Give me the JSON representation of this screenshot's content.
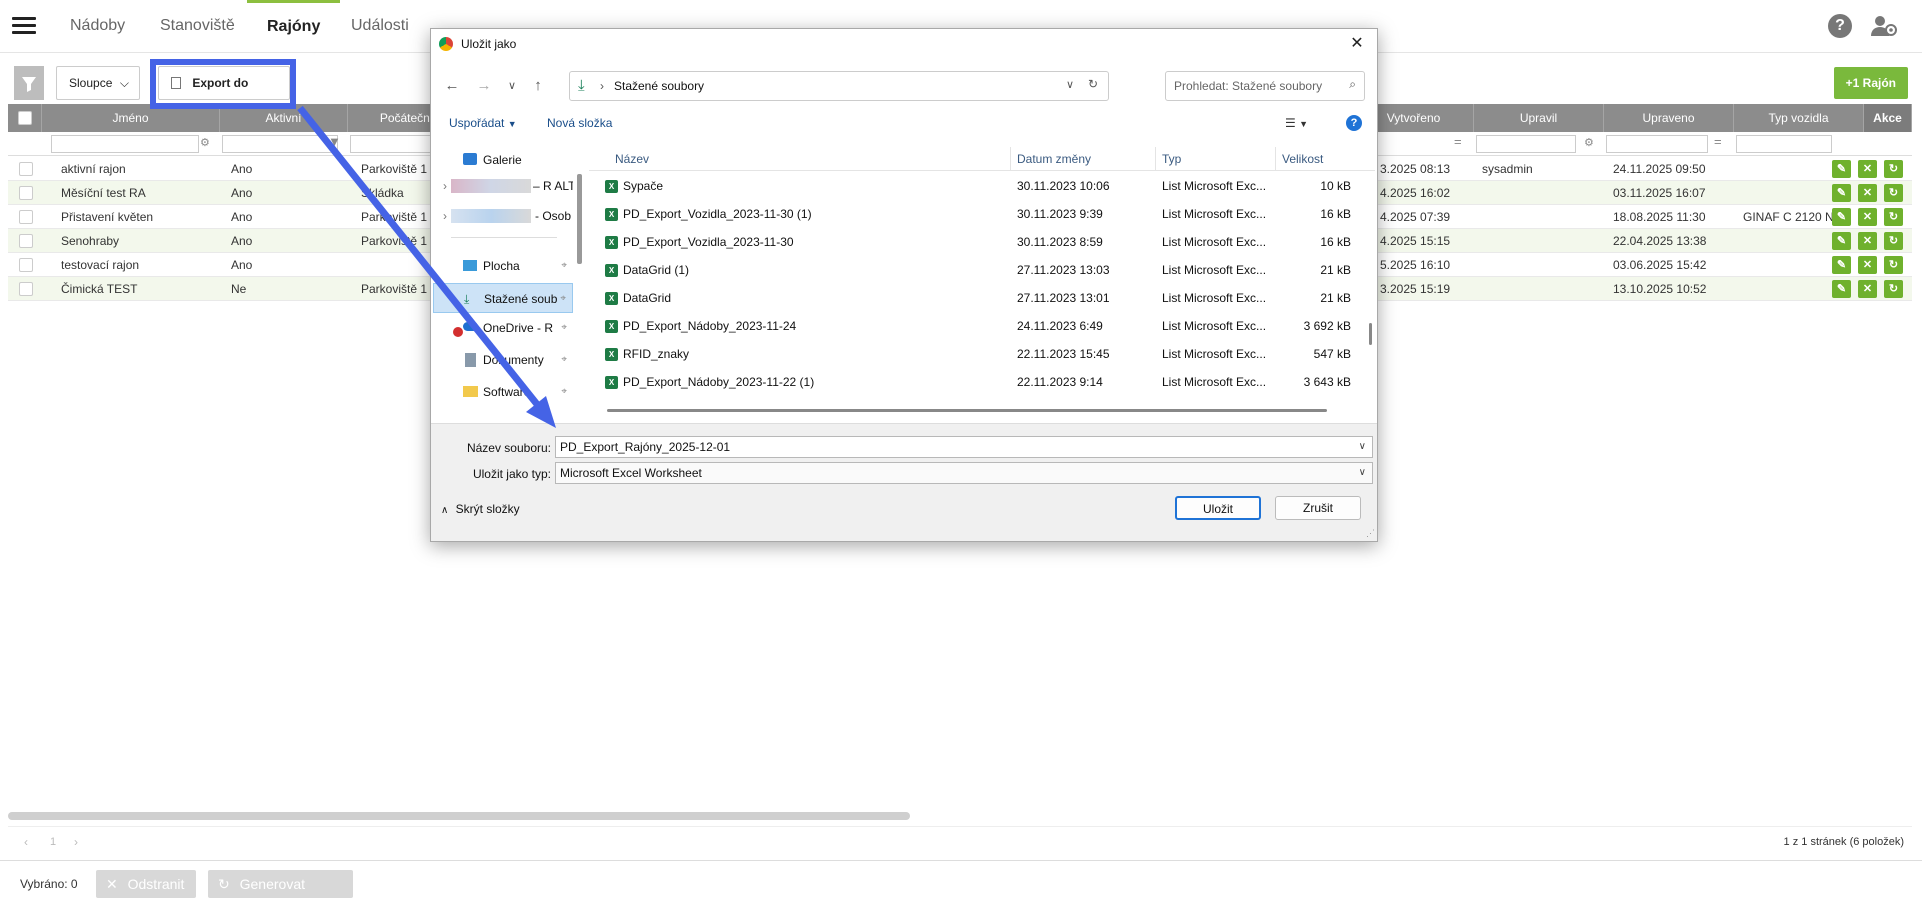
{
  "nav": {
    "tabs": [
      "Nádoby",
      "Stanoviště",
      "Rajóny",
      "Události"
    ],
    "active_tab": "Rajóny",
    "help_label": "?"
  },
  "toolbar": {
    "columns_label": "Sloupce",
    "export_label": "Export do excelu",
    "add_label": "+1 Rajón"
  },
  "grid": {
    "headers": [
      "Jméno",
      "Aktivní",
      "Počáteční",
      "Vytvořeno",
      "Upravil",
      "Upraveno",
      "Typ vozidla",
      "Akce"
    ],
    "rows": [
      {
        "name": "aktivní rajon",
        "active": "Ano",
        "start": "Parkoviště 1",
        "created": "3.2025 08:13",
        "modified_by": "sysadmin",
        "modified": "24.11.2025 09:50",
        "vehicle": ""
      },
      {
        "name": "Měsíční test RA",
        "active": "Ano",
        "start": "Skládka",
        "created": "4.2025 16:02",
        "modified_by": "",
        "modified": "03.11.2025 16:07",
        "vehicle": ""
      },
      {
        "name": "Přistavení květen",
        "active": "Ano",
        "start": "Parkoviště 1",
        "created": "4.2025 07:39",
        "modified_by": "",
        "modified": "18.08.2025 11:30",
        "vehicle": "GINAF C 2120 N"
      },
      {
        "name": "Senohraby",
        "active": "Ano",
        "start": "Parkoviště 1",
        "created": "4.2025 15:15",
        "modified_by": "",
        "modified": "22.04.2025 13:38",
        "vehicle": ""
      },
      {
        "name": "testovací rajon",
        "active": "Ano",
        "start": "",
        "created": "5.2025 16:10",
        "modified_by": "",
        "modified": "03.06.2025 15:42",
        "vehicle": ""
      },
      {
        "name": "Čimická TEST",
        "active": "Ne",
        "start": "Parkoviště 1",
        "created": "3.2025 15:19",
        "modified_by": "",
        "modified": "13.10.2025 10:52",
        "vehicle": ""
      }
    ]
  },
  "pager": {
    "page": "1",
    "summary": "1 z 1 stránek (6 položek)"
  },
  "bottom": {
    "selected": "Vybráno: 0",
    "delete_label": "Odstranit",
    "generate_label": "Generovat svozy"
  },
  "dialog": {
    "title": "Uložit jako",
    "path": "Stažené soubory",
    "search_placeholder": "Prohledat: Stažené soubory",
    "organize": "Uspořádat",
    "new_folder": "Nová složka",
    "sidebar": [
      {
        "label": "Galerie"
      },
      {
        "label": "– R ALT"
      },
      {
        "label": "- Osob"
      },
      {
        "label": "Plocha"
      },
      {
        "label": "Stažené soub"
      },
      {
        "label": "OneDrive - R"
      },
      {
        "label": "Dokumenty"
      },
      {
        "label": "Software"
      }
    ],
    "columns": [
      "Název",
      "Datum změny",
      "Typ",
      "Velikost"
    ],
    "files": [
      {
        "name": "Sypače",
        "date": "30.11.2023 10:06",
        "type": "List Microsoft Exc...",
        "size": "10 kB"
      },
      {
        "name": "PD_Export_Vozidla_2023-11-30 (1)",
        "date": "30.11.2023 9:39",
        "type": "List Microsoft Exc...",
        "size": "16 kB"
      },
      {
        "name": "PD_Export_Vozidla_2023-11-30",
        "date": "30.11.2023 8:59",
        "type": "List Microsoft Exc...",
        "size": "16 kB"
      },
      {
        "name": "DataGrid (1)",
        "date": "27.11.2023 13:03",
        "type": "List Microsoft Exc...",
        "size": "21 kB"
      },
      {
        "name": "DataGrid",
        "date": "27.11.2023 13:01",
        "type": "List Microsoft Exc...",
        "size": "21 kB"
      },
      {
        "name": "PD_Export_Nádoby_2023-11-24",
        "date": "24.11.2023 6:49",
        "type": "List Microsoft Exc...",
        "size": "3 692 kB"
      },
      {
        "name": "RFID_znaky",
        "date": "22.11.2023 15:45",
        "type": "List Microsoft Exc...",
        "size": "547 kB"
      },
      {
        "name": "PD_Export_Nádoby_2023-11-22 (1)",
        "date": "22.11.2023 9:14",
        "type": "List Microsoft Exc...",
        "size": "3 643 kB"
      }
    ],
    "filename_label": "Název souboru:",
    "filename": "PD_Export_Rajóny_2025-12-01",
    "filetype_label": "Uložit jako typ:",
    "filetype": "Microsoft Excel Worksheet",
    "hide_folders": "Skrýt složky",
    "save": "Uložit",
    "cancel": "Zrušit"
  },
  "colors": {
    "accent": "#7ab93c",
    "header": "#8c8c8c",
    "annotation": "#4563e6"
  }
}
